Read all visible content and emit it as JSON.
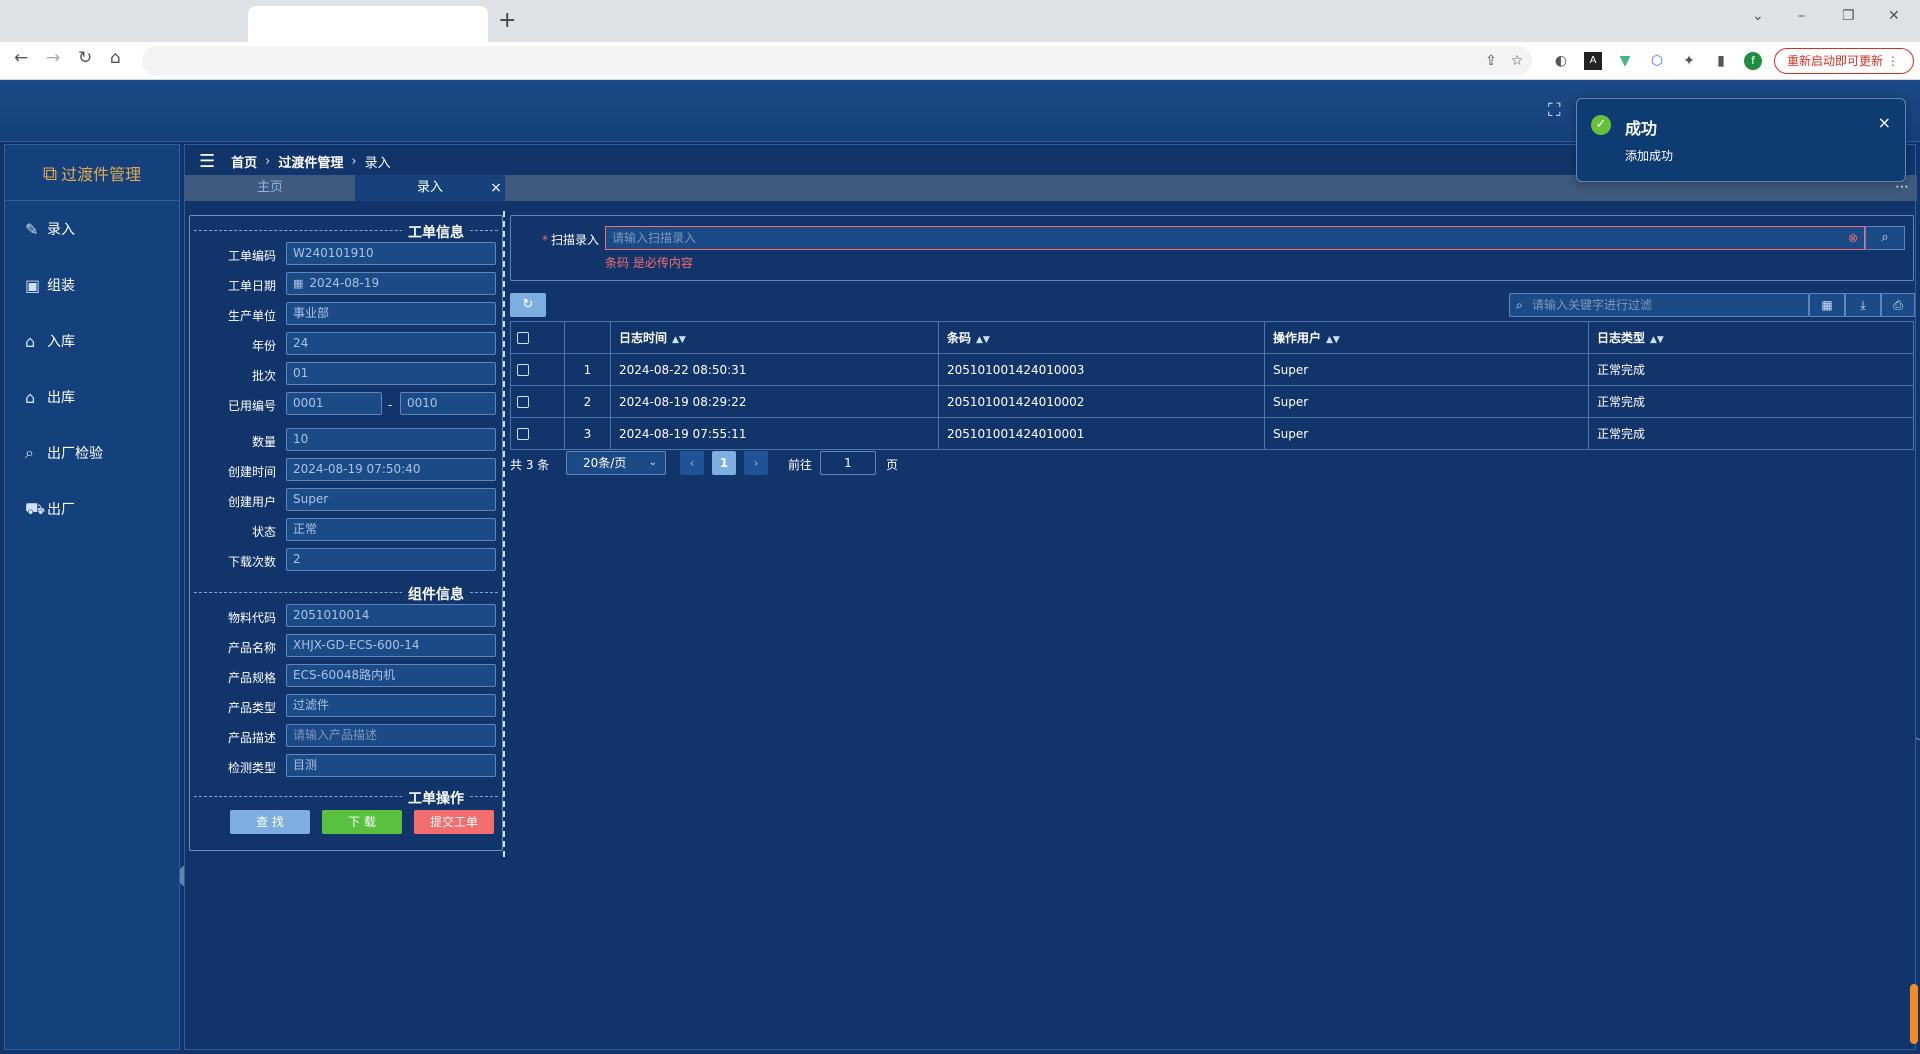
{
  "browser": {
    "new_tab": "+",
    "update_button": "重新启动即可更新"
  },
  "app": {
    "brand": "过渡件管理",
    "menu": [
      {
        "label": "录入",
        "icon": "edit-icon"
      },
      {
        "label": "组装",
        "icon": "assemble-icon"
      },
      {
        "label": "入库",
        "icon": "warehouse-in-icon"
      },
      {
        "label": "出库",
        "icon": "warehouse-out-icon"
      },
      {
        "label": "出厂检验",
        "icon": "inspect-icon"
      },
      {
        "label": "出厂",
        "icon": "truck-icon"
      }
    ],
    "breadcrumb": [
      "首页",
      "过渡件管理",
      "录入"
    ],
    "tabs": {
      "home": "主页",
      "entry": "录入",
      "close": "×",
      "more": "⋯"
    }
  },
  "form": {
    "section_order": "工单信息",
    "fields_order": [
      {
        "label": "工单编码",
        "value": "W240101910"
      },
      {
        "label": "工单日期",
        "value": "2024-08-19"
      },
      {
        "label": "生产单位",
        "value": "事业部"
      },
      {
        "label": "年份",
        "value": "24"
      },
      {
        "label": "批次",
        "value": "01"
      }
    ],
    "used_number": {
      "label": "已用编号",
      "from": "0001",
      "sep": "-",
      "to": "0010"
    },
    "fields_order2": [
      {
        "label": "数量",
        "value": "10"
      },
      {
        "label": "创建时间",
        "value": "2024-08-19 07:50:40"
      },
      {
        "label": "创建用户",
        "value": "Super"
      },
      {
        "label": "状态",
        "value": "正常"
      },
      {
        "label": "下载次数",
        "value": "2"
      }
    ],
    "section_component": "组件信息",
    "fields_component": [
      {
        "label": "物料代码",
        "value": "2051010014"
      },
      {
        "label": "产品名称",
        "value": "XHJX-GD-ECS-600-14"
      },
      {
        "label": "产品规格",
        "value": "ECS-60048路内机"
      },
      {
        "label": "产品类型",
        "value": "过滤件"
      },
      {
        "label": "产品描述",
        "value": "请输入产品描述"
      },
      {
        "label": "检测类型",
        "value": "目测"
      }
    ],
    "section_ops": "工单操作",
    "buttons": {
      "find": "查 找",
      "download": "下 载",
      "submit": "提交工单"
    }
  },
  "scan": {
    "label": "扫描录入",
    "required_mark": "*",
    "placeholder": "请输入扫描录入",
    "error": "条码 是必传内容"
  },
  "filter": {
    "placeholder": "请输入关键字进行过滤"
  },
  "table": {
    "columns": [
      "日志时间",
      "条码",
      "操作用户",
      "日志类型"
    ],
    "rows": [
      {
        "index": "1",
        "time": "2024-08-22 08:50:31",
        "code": "205101001424010003",
        "user": "Super",
        "type": "正常完成"
      },
      {
        "index": "2",
        "time": "2024-08-19 08:29:22",
        "code": "205101001424010002",
        "user": "Super",
        "type": "正常完成"
      },
      {
        "index": "3",
        "time": "2024-08-19 07:55:11",
        "code": "205101001424010001",
        "user": "Super",
        "type": "正常完成"
      }
    ]
  },
  "pager": {
    "total": "共 3 条",
    "page_size": "20条/页",
    "current": "1",
    "goto_label": "前往",
    "goto_value": "1",
    "page_label": "页"
  },
  "toast": {
    "title": "成功",
    "message": "添加成功",
    "close": "×"
  },
  "colors": {
    "background": "#11356b",
    "accent": "#7eaee0",
    "success": "#67c23a",
    "danger": "#f56c6c",
    "brand": "#e3a94f"
  }
}
